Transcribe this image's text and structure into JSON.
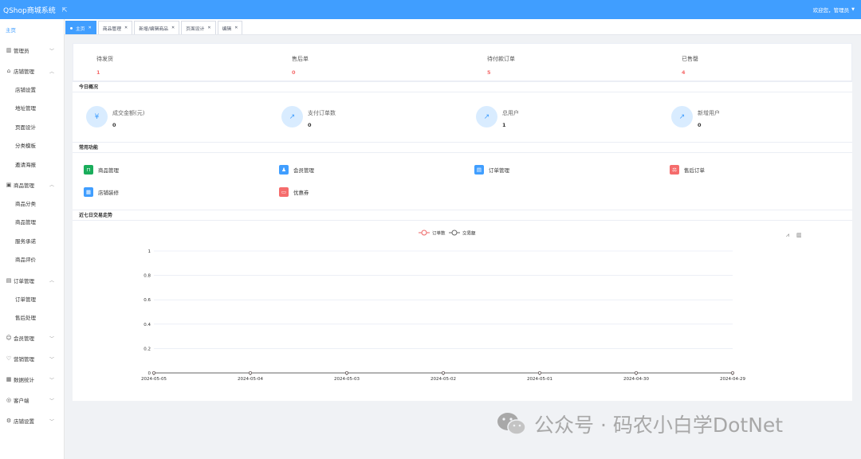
{
  "app": {
    "title": "QShop商城系统",
    "welcome": "欢迎您，管理员"
  },
  "sidebar": {
    "home": "主页",
    "groups": [
      {
        "label": "管理员",
        "icon": "bar-chart-icon",
        "expanded": false,
        "items": []
      },
      {
        "label": "店铺管理",
        "icon": "shop-icon",
        "expanded": true,
        "items": [
          "店铺设置",
          "地址管理",
          "页面设计",
          "分类模板",
          "邀请海报"
        ]
      },
      {
        "label": "商品管理",
        "icon": "goods-icon",
        "expanded": true,
        "items": [
          "商品分类",
          "商品管理",
          "服务承诺",
          "商品评价"
        ]
      },
      {
        "label": "订单管理",
        "icon": "order-icon",
        "expanded": true,
        "items": [
          "订单管理",
          "售后处理"
        ]
      },
      {
        "label": "会员管理",
        "icon": "user-icon",
        "expanded": false,
        "items": []
      },
      {
        "label": "营销管理",
        "icon": "heart-icon",
        "expanded": false,
        "items": []
      },
      {
        "label": "数据统计",
        "icon": "stats-icon",
        "expanded": false,
        "items": []
      },
      {
        "label": "客户端",
        "icon": "client-icon",
        "expanded": false,
        "items": []
      },
      {
        "label": "店铺设置",
        "icon": "settings-icon",
        "expanded": false,
        "items": []
      }
    ]
  },
  "tabs": [
    {
      "label": "主页",
      "active": true
    },
    {
      "label": "商品管理",
      "active": false
    },
    {
      "label": "新增/编辑商品",
      "active": false
    },
    {
      "label": "页面设计",
      "active": false
    },
    {
      "label": "编辑",
      "active": false
    }
  ],
  "stats": [
    {
      "label": "待发货",
      "value": "1"
    },
    {
      "label": "售后单",
      "value": "0"
    },
    {
      "label": "待付款订单",
      "value": "5"
    },
    {
      "label": "已售罄",
      "value": "4"
    }
  ],
  "overview": {
    "title": "今日概况",
    "items": [
      {
        "label": "成交金额(元)",
        "value": "0",
        "icon": "yen-icon"
      },
      {
        "label": "支付订单数",
        "value": "0",
        "icon": "line-chart-icon"
      },
      {
        "label": "总用户",
        "value": "1",
        "icon": "line-chart-icon"
      },
      {
        "label": "新增用户",
        "value": "0",
        "icon": "line-chart-icon"
      }
    ]
  },
  "functions": {
    "title": "常用功能",
    "items": [
      {
        "label": "商品管理",
        "color": "#1aad5b",
        "icon": "bag-icon"
      },
      {
        "label": "会员管理",
        "color": "#409eff",
        "icon": "member-icon"
      },
      {
        "label": "订单管理",
        "color": "#409eff",
        "icon": "document-icon"
      },
      {
        "label": "售后订单",
        "color": "#f56c6c",
        "icon": "aftersale-icon"
      },
      {
        "label": "店铺装修",
        "color": "#409eff",
        "icon": "decorate-icon"
      },
      {
        "label": "优惠券",
        "color": "#f56c6c",
        "icon": "coupon-icon"
      }
    ]
  },
  "trend": {
    "title": "近七日交易走势",
    "toolbox": [
      "line-switch-icon",
      "bar-switch-icon"
    ]
  },
  "chart_data": {
    "type": "line",
    "x": [
      "2024-05-05",
      "2024-05-04",
      "2024-05-03",
      "2024-05-02",
      "2024-05-01",
      "2024-04-30",
      "2024-04-29"
    ],
    "series": [
      {
        "name": "订单数",
        "values": [
          0,
          0,
          0,
          0,
          0,
          0,
          0
        ],
        "color": "#ee6666"
      },
      {
        "name": "交易额",
        "values": [
          0,
          0,
          0,
          0,
          0,
          0,
          0
        ],
        "color": "#666666"
      }
    ],
    "yticks": [
      "0",
      "0.2",
      "0.4",
      "0.6",
      "0.8",
      "1"
    ],
    "ylim": [
      0,
      1
    ],
    "grid": true,
    "legend": "top-center"
  },
  "watermark": {
    "text": "公众号 · 码农小白学DotNet"
  }
}
